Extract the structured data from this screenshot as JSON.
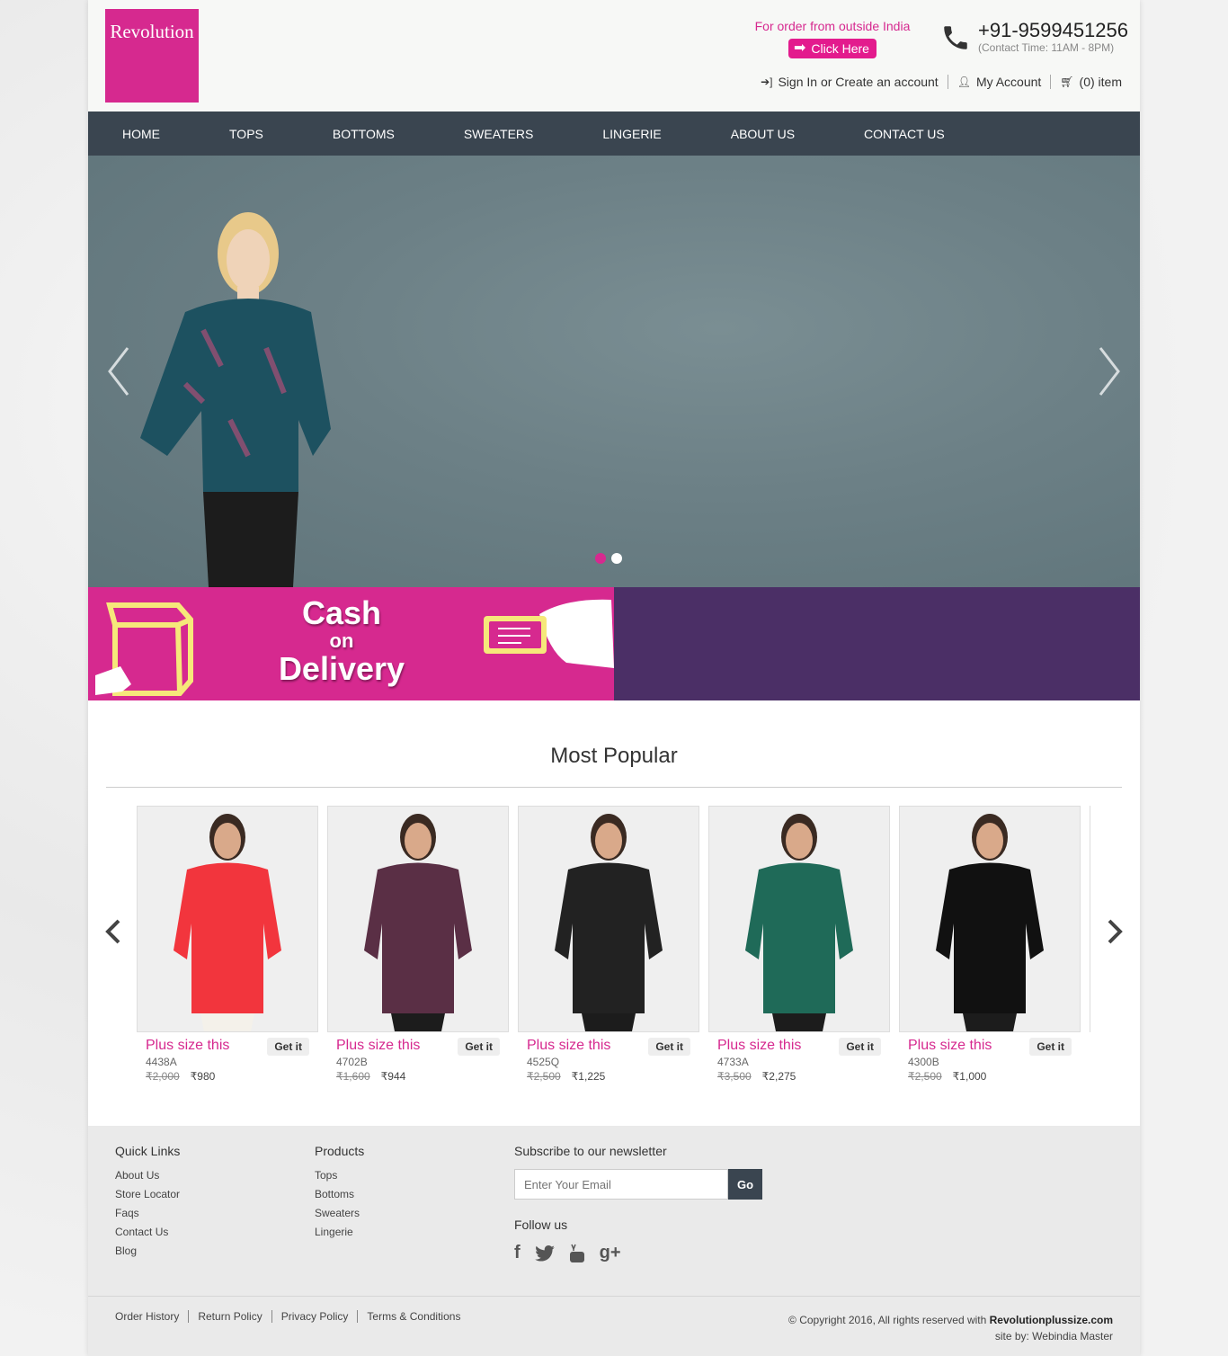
{
  "header": {
    "logo_text": "Revolution",
    "outside_text": "For order from outside India",
    "click_here": "Click Here",
    "phone": "+91-9599451256",
    "contact_time": "(Contact Time: 11AM - 8PM)",
    "sign_in": "Sign In or Create an account",
    "my_account": "My Account",
    "cart": "(0) item"
  },
  "nav": {
    "items": [
      "HOME",
      "TOPS",
      "BOTTOMS",
      "SWEATERS",
      "LINGERIE",
      "ABOUT US",
      "CONTACT US"
    ]
  },
  "cod": {
    "line1": "Cash",
    "line2": "on",
    "line3": "Delivery"
  },
  "popular": {
    "title": "Most Popular",
    "get_label": "Get it",
    "products": [
      {
        "name": "Plus size this",
        "code": "4438A",
        "old_price": "₹2,000",
        "price": "₹980",
        "color": "#f2353d"
      },
      {
        "name": "Plus size this",
        "code": "4702B",
        "old_price": "₹1,600",
        "price": "₹944",
        "color": "#5a2f45"
      },
      {
        "name": "Plus size this",
        "code": "4525Q",
        "old_price": "₹2,500",
        "price": "₹1,225",
        "color": "#222222"
      },
      {
        "name": "Plus size this",
        "code": "4733A",
        "old_price": "₹3,500",
        "price": "₹2,275",
        "color": "#1f6a58"
      },
      {
        "name": "Plus size this",
        "code": "4300B",
        "old_price": "₹2,500",
        "price": "₹1,000",
        "color": "#111111"
      }
    ]
  },
  "footer": {
    "quick_links_title": "Quick Links",
    "quick_links": [
      "About Us",
      "Store Locator",
      "Faqs",
      "Contact Us",
      "Blog"
    ],
    "products_title": "Products",
    "products": [
      "Tops",
      "Bottoms",
      "Sweaters",
      "Lingerie"
    ],
    "newsletter_title": "Subscribe to our newsletter",
    "email_placeholder": "Enter Your Email",
    "go": "Go",
    "follow_us": "Follow us",
    "policies": [
      "Order History",
      "Return Policy",
      "Privacy Policy",
      "Terms & Conditions"
    ],
    "copyright_prefix": "© Copyright 2016, All rights reserved with",
    "copyright_site": "Revolutionplussize.com",
    "site_by": "site by:  Webindia Master"
  },
  "colors": {
    "brand": "#d6298f",
    "nav": "#3a4550",
    "cod_right": "#4b2f66"
  }
}
